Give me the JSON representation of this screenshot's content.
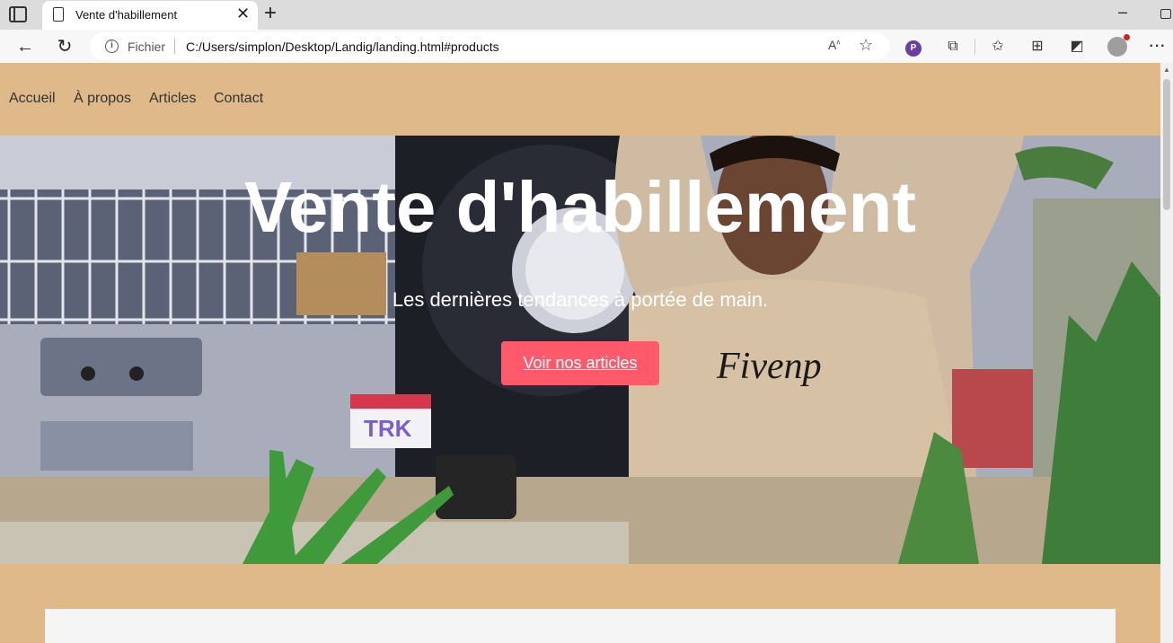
{
  "browser": {
    "tab_title": "Vente d'habillement",
    "site_info_label": "Fichier",
    "url": "C:/Users/simplon/Desktop/Landig/landing.html#products",
    "read_aloud_label": "A̅",
    "extension_label": "P"
  },
  "nav": {
    "items": [
      "Accueil",
      "À propos",
      "Articles",
      "Contact"
    ]
  },
  "hero": {
    "title": "Vente d'habillement",
    "subtitle": "Les dernières tendances à portée de main.",
    "cta_label": "Voir nos articles",
    "cta_color": "#ff5a6b",
    "tshirt_print": "Fivenp"
  },
  "colors": {
    "page_background": "#dfb989",
    "card_background": "#f5f5f5"
  }
}
